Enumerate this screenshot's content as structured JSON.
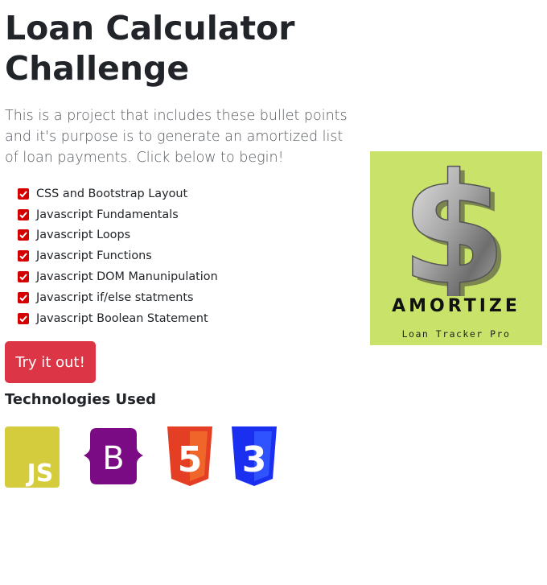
{
  "page": {
    "title": "Loan Calculator Challenge",
    "lead": "This is a project that includes these bullet points and it's purpose is to generate an amortized list of loan payments. Click below to begin!"
  },
  "features": [
    "CSS and Bootstrap Layout",
    "Javascript Fundamentals",
    "Javascript Loops",
    "Javascript Functions",
    "Javascript DOM Manunipulation",
    "Javascript if/else statments",
    "Javascript Boolean Statement"
  ],
  "cta": {
    "label": "Try it out!",
    "color": "#dc3545"
  },
  "technologies": {
    "heading": "Technologies Used",
    "icons": [
      {
        "name": "javascript-icon",
        "text": "JS",
        "color": "#d4cc3c"
      },
      {
        "name": "bootstrap-icon",
        "text": "B",
        "color": "#7b0b85"
      },
      {
        "name": "html5-icon",
        "text": "5",
        "color": "#e43f24"
      },
      {
        "name": "css3-icon",
        "text": "3",
        "color": "#1a2ff0"
      }
    ]
  },
  "logo": {
    "title": "AMORTIZE",
    "subtitle": "Loan Tracker Pro",
    "background": "#c9e26a",
    "symbol": "$"
  }
}
